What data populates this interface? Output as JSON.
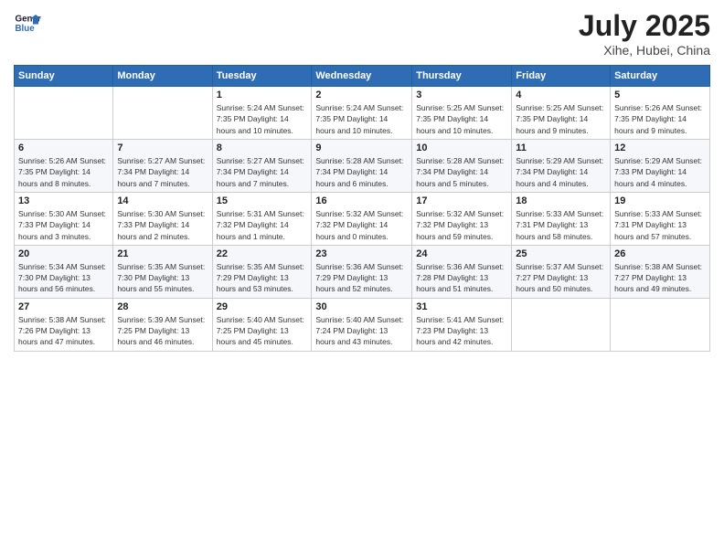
{
  "logo": {
    "text_general": "General",
    "text_blue": "Blue"
  },
  "header": {
    "month_year": "July 2025",
    "location": "Xihe, Hubei, China"
  },
  "weekdays": [
    "Sunday",
    "Monday",
    "Tuesday",
    "Wednesday",
    "Thursday",
    "Friday",
    "Saturday"
  ],
  "weeks": [
    [
      {
        "day": "",
        "info": ""
      },
      {
        "day": "",
        "info": ""
      },
      {
        "day": "1",
        "info": "Sunrise: 5:24 AM\nSunset: 7:35 PM\nDaylight: 14 hours and 10 minutes."
      },
      {
        "day": "2",
        "info": "Sunrise: 5:24 AM\nSunset: 7:35 PM\nDaylight: 14 hours and 10 minutes."
      },
      {
        "day": "3",
        "info": "Sunrise: 5:25 AM\nSunset: 7:35 PM\nDaylight: 14 hours and 10 minutes."
      },
      {
        "day": "4",
        "info": "Sunrise: 5:25 AM\nSunset: 7:35 PM\nDaylight: 14 hours and 9 minutes."
      },
      {
        "day": "5",
        "info": "Sunrise: 5:26 AM\nSunset: 7:35 PM\nDaylight: 14 hours and 9 minutes."
      }
    ],
    [
      {
        "day": "6",
        "info": "Sunrise: 5:26 AM\nSunset: 7:35 PM\nDaylight: 14 hours and 8 minutes."
      },
      {
        "day": "7",
        "info": "Sunrise: 5:27 AM\nSunset: 7:34 PM\nDaylight: 14 hours and 7 minutes."
      },
      {
        "day": "8",
        "info": "Sunrise: 5:27 AM\nSunset: 7:34 PM\nDaylight: 14 hours and 7 minutes."
      },
      {
        "day": "9",
        "info": "Sunrise: 5:28 AM\nSunset: 7:34 PM\nDaylight: 14 hours and 6 minutes."
      },
      {
        "day": "10",
        "info": "Sunrise: 5:28 AM\nSunset: 7:34 PM\nDaylight: 14 hours and 5 minutes."
      },
      {
        "day": "11",
        "info": "Sunrise: 5:29 AM\nSunset: 7:34 PM\nDaylight: 14 hours and 4 minutes."
      },
      {
        "day": "12",
        "info": "Sunrise: 5:29 AM\nSunset: 7:33 PM\nDaylight: 14 hours and 4 minutes."
      }
    ],
    [
      {
        "day": "13",
        "info": "Sunrise: 5:30 AM\nSunset: 7:33 PM\nDaylight: 14 hours and 3 minutes."
      },
      {
        "day": "14",
        "info": "Sunrise: 5:30 AM\nSunset: 7:33 PM\nDaylight: 14 hours and 2 minutes."
      },
      {
        "day": "15",
        "info": "Sunrise: 5:31 AM\nSunset: 7:32 PM\nDaylight: 14 hours and 1 minute."
      },
      {
        "day": "16",
        "info": "Sunrise: 5:32 AM\nSunset: 7:32 PM\nDaylight: 14 hours and 0 minutes."
      },
      {
        "day": "17",
        "info": "Sunrise: 5:32 AM\nSunset: 7:32 PM\nDaylight: 13 hours and 59 minutes."
      },
      {
        "day": "18",
        "info": "Sunrise: 5:33 AM\nSunset: 7:31 PM\nDaylight: 13 hours and 58 minutes."
      },
      {
        "day": "19",
        "info": "Sunrise: 5:33 AM\nSunset: 7:31 PM\nDaylight: 13 hours and 57 minutes."
      }
    ],
    [
      {
        "day": "20",
        "info": "Sunrise: 5:34 AM\nSunset: 7:30 PM\nDaylight: 13 hours and 56 minutes."
      },
      {
        "day": "21",
        "info": "Sunrise: 5:35 AM\nSunset: 7:30 PM\nDaylight: 13 hours and 55 minutes."
      },
      {
        "day": "22",
        "info": "Sunrise: 5:35 AM\nSunset: 7:29 PM\nDaylight: 13 hours and 53 minutes."
      },
      {
        "day": "23",
        "info": "Sunrise: 5:36 AM\nSunset: 7:29 PM\nDaylight: 13 hours and 52 minutes."
      },
      {
        "day": "24",
        "info": "Sunrise: 5:36 AM\nSunset: 7:28 PM\nDaylight: 13 hours and 51 minutes."
      },
      {
        "day": "25",
        "info": "Sunrise: 5:37 AM\nSunset: 7:27 PM\nDaylight: 13 hours and 50 minutes."
      },
      {
        "day": "26",
        "info": "Sunrise: 5:38 AM\nSunset: 7:27 PM\nDaylight: 13 hours and 49 minutes."
      }
    ],
    [
      {
        "day": "27",
        "info": "Sunrise: 5:38 AM\nSunset: 7:26 PM\nDaylight: 13 hours and 47 minutes."
      },
      {
        "day": "28",
        "info": "Sunrise: 5:39 AM\nSunset: 7:25 PM\nDaylight: 13 hours and 46 minutes."
      },
      {
        "day": "29",
        "info": "Sunrise: 5:40 AM\nSunset: 7:25 PM\nDaylight: 13 hours and 45 minutes."
      },
      {
        "day": "30",
        "info": "Sunrise: 5:40 AM\nSunset: 7:24 PM\nDaylight: 13 hours and 43 minutes."
      },
      {
        "day": "31",
        "info": "Sunrise: 5:41 AM\nSunset: 7:23 PM\nDaylight: 13 hours and 42 minutes."
      },
      {
        "day": "",
        "info": ""
      },
      {
        "day": "",
        "info": ""
      }
    ]
  ]
}
